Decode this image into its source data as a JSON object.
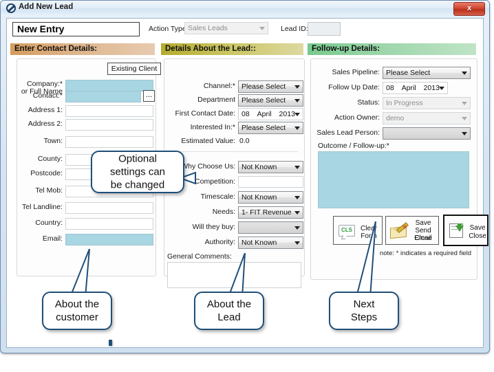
{
  "window": {
    "title": "Add New Lead",
    "close_label": "x",
    "icon": "app-logo-icon"
  },
  "top": {
    "entry_value": "New Entry",
    "action_type_label": "Action Type:",
    "action_type_value": "Sales Leads",
    "lead_id_label": "Lead ID:",
    "lead_id_value": ""
  },
  "panels": {
    "contact_header": "Enter Contact Details:",
    "lead_header": "Details About the Lead::",
    "follow_header": "Follow-up Details:"
  },
  "contact": {
    "existing_client_button": "Existing Client",
    "browse_button": "...",
    "fields": [
      {
        "label": "Company:*",
        "label2": "or Full Name",
        "value": "",
        "required": true
      },
      {
        "label": "Contact:*",
        "value": "",
        "required": true
      },
      {
        "label": "Address 1:",
        "value": "",
        "required": false
      },
      {
        "label": "Address 2:",
        "value": "",
        "required": false
      },
      {
        "label": "Town:",
        "value": "",
        "required": false
      },
      {
        "label": "County:",
        "value": "",
        "required": false
      },
      {
        "label": "Postcode:",
        "value": "",
        "required": false
      },
      {
        "label": "Tel Mob:",
        "value": "",
        "required": false
      },
      {
        "label": "Tel Landline:",
        "value": "",
        "required": false
      },
      {
        "label": "Country:",
        "value": "",
        "required": false
      },
      {
        "label": "Email:",
        "value": "",
        "required": true
      }
    ]
  },
  "lead": {
    "channel_label": "Channel:*",
    "channel_value": "Please Select",
    "department_label": "Department",
    "department_value": "Please Select",
    "first_contact_label": "First Contact Date:",
    "first_contact_day": "08",
    "first_contact_month": "April",
    "first_contact_year": "2013",
    "interested_label": "Interested In:*",
    "interested_value": "Please Select",
    "estimated_label": "Estimated Value:",
    "estimated_value": "0.0",
    "why_label": "Why Choose Us:",
    "why_value": "Not Known",
    "competition_label": "Competition:",
    "competition_value": "",
    "timescale_label": "Timescale:",
    "timescale_value": "Not Known",
    "needs_label": "Needs:",
    "needs_value": "1- FIT Revenue",
    "willbuy_label": "Will they buy:",
    "willbuy_value": "",
    "authority_label": "Authority:",
    "authority_value": "Not Known",
    "comments_label": "General Comments:",
    "comments_value": ""
  },
  "follow": {
    "pipeline_label": "Sales Pipeline:",
    "pipeline_value": "Please Select",
    "followup_date_label": "Follow Up Date:",
    "followup_day": "08",
    "followup_month": "April",
    "followup_year": "2013",
    "status_label": "Status:",
    "status_value": "In Progress",
    "owner_label": "Action Owner:",
    "owner_value": "demo",
    "lead_person_label": "Sales Lead Person:",
    "lead_person_value": "",
    "outcome_label": "Outcome / Follow-up:*",
    "outcome_value": "",
    "note": "note: * indicates a required field"
  },
  "actions": {
    "clear_form": "Clear\nForm",
    "clear_form_l1": "Clear",
    "clear_form_l2": "Form",
    "clear_icon_text": "CLS",
    "save_email_l1": "Save",
    "save_email_l2": "Send Email",
    "save_email_l3": "Close",
    "save_close_l1": "Save",
    "save_close_l2": "Close"
  },
  "callouts": {
    "optional_l1": "Optional",
    "optional_l2": "settings can",
    "optional_l3": "be changed",
    "customer_l1": "About the",
    "customer_l2": "customer",
    "lead_l1": "About the",
    "lead_l2": "Lead",
    "next_l1": "Next",
    "next_l2": "Steps"
  },
  "colors": {
    "required_field": "#a8d6e2",
    "contact_header": "#d49c5e",
    "lead_header": "#b5ab2f",
    "follow_header": "#77c98d",
    "callout_border": "#1f4e79",
    "close_button": "#c9402a"
  }
}
